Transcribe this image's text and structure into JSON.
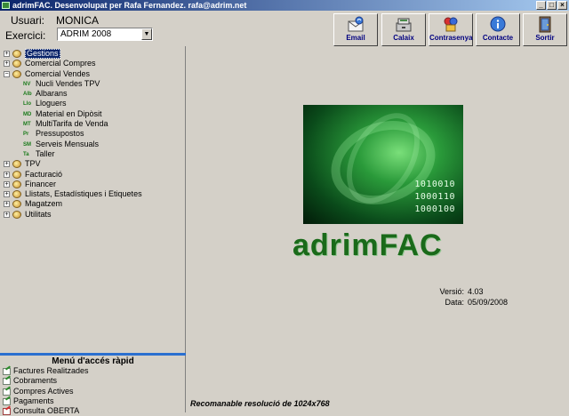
{
  "window": {
    "title": "adrimFAC. Desenvolupat per Rafa Fernandez. rafa@adrim.net",
    "controls": [
      "_",
      "□",
      "×"
    ]
  },
  "header": {
    "user_label": "Usuari:",
    "user_value": "MONICA",
    "exercise_label": "Exercici:",
    "exercise_value": "ADRIM 2008"
  },
  "toolbar": {
    "buttons": [
      {
        "label": "Email",
        "icon": "email-icon"
      },
      {
        "label": "Calaix",
        "icon": "cash-drawer-icon"
      },
      {
        "label": "Contrasenya",
        "icon": "password-icon"
      },
      {
        "label": "Contacte",
        "icon": "info-icon"
      },
      {
        "label": "Sortir",
        "icon": "exit-door-icon"
      }
    ]
  },
  "tree": {
    "items": [
      {
        "label": "Gestions",
        "expander": "+",
        "selected": true
      },
      {
        "label": "Comercial Compres",
        "expander": "+"
      },
      {
        "label": "Comercial Vendes",
        "expander": "−"
      },
      {
        "label": "TPV",
        "expander": "+"
      },
      {
        "label": "Facturació",
        "expander": "+"
      },
      {
        "label": "Financer",
        "expander": "+"
      },
      {
        "label": "Llistats, Estadístiques i Etiquetes",
        "expander": "+"
      },
      {
        "label": "Magatzem",
        "expander": "+"
      },
      {
        "label": "Utilitats",
        "expander": "+"
      }
    ],
    "children": [
      {
        "label": "Nucli Vendes TPV",
        "code": "NV"
      },
      {
        "label": "Albarans",
        "code": "Alb"
      },
      {
        "label": "Lloguers",
        "code": "Llo"
      },
      {
        "label": "Material en Dipòsit",
        "code": "MD"
      },
      {
        "label": "MultiTarifa de Venda",
        "code": "MT"
      },
      {
        "label": "Pressupostos",
        "code": "Pr"
      },
      {
        "label": "Serveis Mensuals",
        "code": "SM"
      },
      {
        "label": "Taller",
        "code": "Ta"
      }
    ]
  },
  "quick_access": {
    "title": "Menú d'accés ràpid",
    "items": [
      {
        "label": "Factures Realitzades"
      },
      {
        "label": "Cobraments"
      },
      {
        "label": "Compres Actives"
      },
      {
        "label": "Pagaments"
      },
      {
        "label": "Consulta OBERTA"
      }
    ]
  },
  "splash": {
    "binary": [
      "1010010",
      "1000110",
      "1000100"
    ],
    "brand": "adrimFAC",
    "version_label": "Versió:",
    "version_value": "4.03",
    "date_label": "Data:",
    "date_value": "05/09/2008",
    "resolution_note": "Recomanable resolució de 1024x768"
  },
  "colors": {
    "title_bar": "#0a246a",
    "accent_blue": "#2a6fd0",
    "brand_green": "#1a6a1a",
    "window_bg": "#d4d0c8"
  }
}
